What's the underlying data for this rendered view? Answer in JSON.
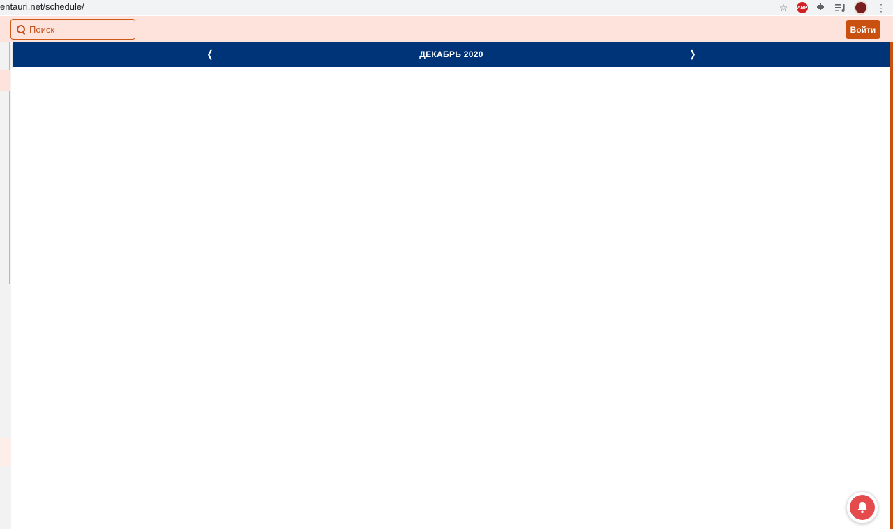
{
  "browser": {
    "url": "entauri.net/schedule/",
    "icons": [
      "star-icon",
      "adblock-icon",
      "extensions-icon",
      "media-icon",
      "profile-icon",
      "menu-icon"
    ],
    "abp_label": "ABP"
  },
  "header": {
    "search_placeholder": "Поиск",
    "login_label": "Войти"
  },
  "calendar": {
    "month_title": "ДЕКАБРЬ 2020",
    "prev_label": "❬",
    "next_label": "❭"
  },
  "colors": {
    "accent": "#c9500f",
    "header_bg": "#fde3dc",
    "nav_bg": "#003479",
    "bell_red": "#e54b4d"
  }
}
